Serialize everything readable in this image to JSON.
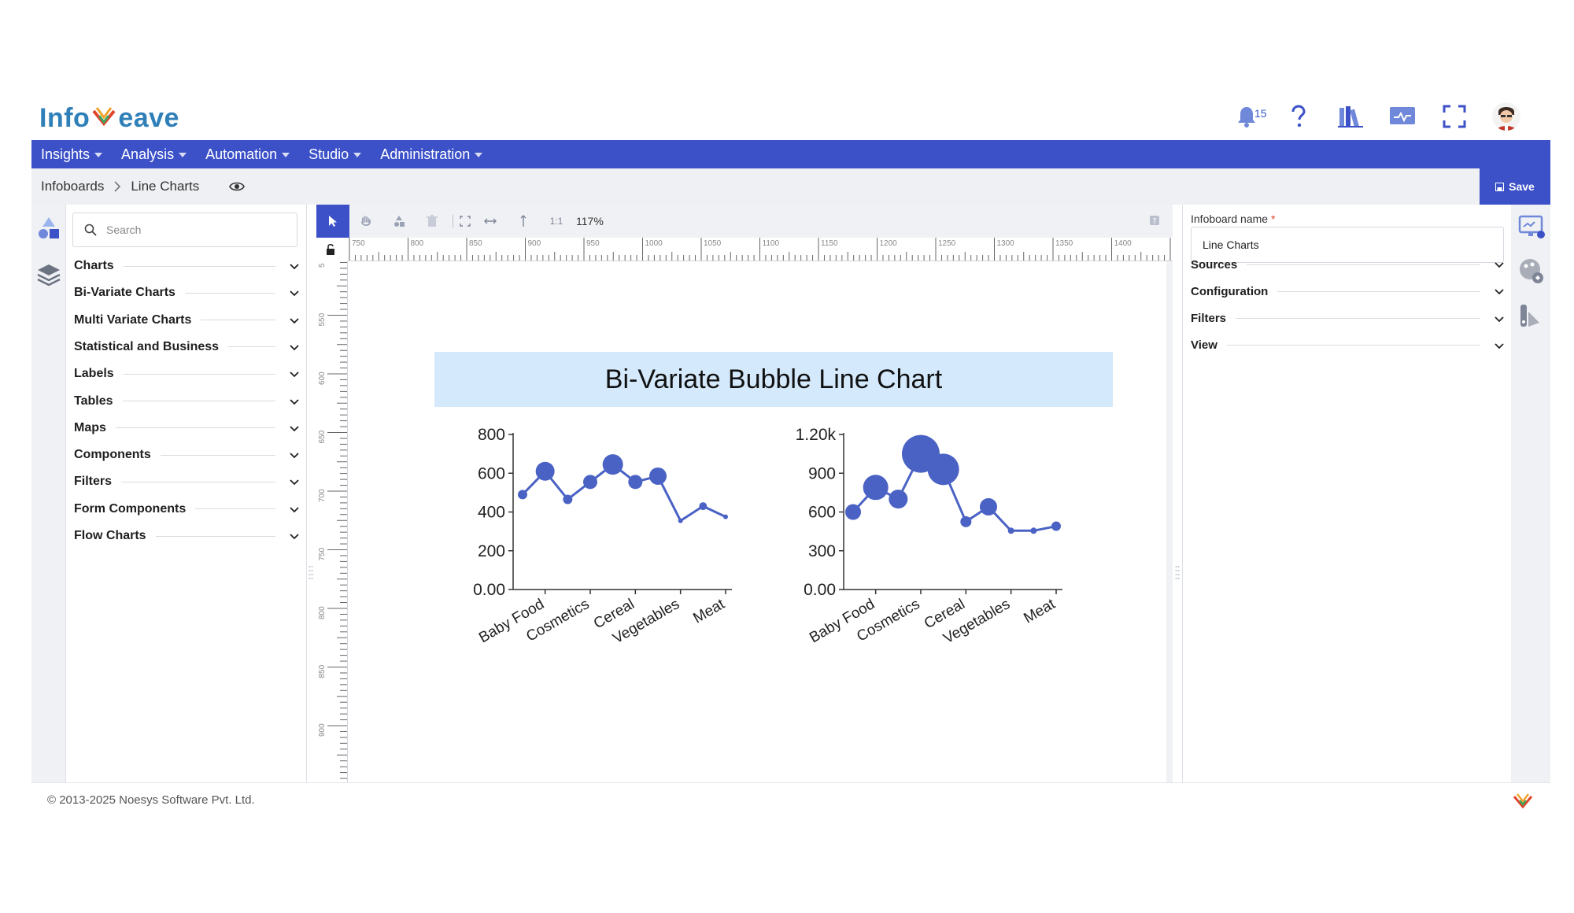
{
  "header": {
    "logo_text_left": "Info",
    "logo_text_right": "eave",
    "notification_count": "15"
  },
  "menu": [
    {
      "label": "Insights"
    },
    {
      "label": "Analysis"
    },
    {
      "label": "Automation"
    },
    {
      "label": "Studio"
    },
    {
      "label": "Administration"
    }
  ],
  "breadcrumb": {
    "root": "Infoboards",
    "current": "Line Charts",
    "save_label": "Save"
  },
  "left_panel": {
    "search_placeholder": "Search",
    "categories": [
      {
        "label": "Charts"
      },
      {
        "label": "Bi-Variate Charts"
      },
      {
        "label": "Multi Variate Charts"
      },
      {
        "label": "Statistical and Business"
      },
      {
        "label": "Labels"
      },
      {
        "label": "Tables"
      },
      {
        "label": "Maps"
      },
      {
        "label": "Components"
      },
      {
        "label": "Filters"
      },
      {
        "label": "Form Components"
      },
      {
        "label": "Flow Charts"
      }
    ]
  },
  "toolbar": {
    "ratio_label": "1:1",
    "zoom": "117%"
  },
  "rulers": {
    "top_ticks": [
      "750",
      "800",
      "850",
      "900",
      "950",
      "1000",
      "1050",
      "1100",
      "1150",
      "1200",
      "1250",
      "1300",
      "1350",
      "1400",
      "14"
    ],
    "left_ticks": [
      "5",
      "550",
      "600",
      "650",
      "700",
      "750",
      "800",
      "850",
      "900"
    ]
  },
  "right_panel": {
    "name_label": "Infoboard name",
    "name_required": "*",
    "name_value": "Line Charts",
    "sections": [
      {
        "label": "Sources"
      },
      {
        "label": "Configuration"
      },
      {
        "label": "Filters"
      },
      {
        "label": "View"
      }
    ]
  },
  "footer": {
    "copyright": "© 2013-2025 Noesys Software Pvt. Ltd."
  },
  "colors": {
    "brand": "#3c51c8",
    "series": "#4a62c4",
    "title_bg": "#d4e9fb"
  },
  "chart_data": [
    {
      "type": "line",
      "title": "Bi-Variate Bubble Line Chart",
      "categories": [
        "Baby Food",
        "",
        "Cosmetics",
        "",
        "Cereal",
        "",
        "Vegetables",
        "",
        "Meat",
        ""
      ],
      "x_tick_labels": [
        "Baby Food",
        "Cosmetics",
        "Cereal",
        "Vegetables",
        "Meat"
      ],
      "y_tick_labels": [
        "800",
        "600",
        "400",
        "200",
        "0.00"
      ],
      "ylim": [
        0,
        800
      ],
      "series": [
        {
          "values": [
            490,
            610,
            465,
            555,
            645,
            555,
            585,
            355,
            430,
            375
          ],
          "bubble_size": [
            6,
            12,
            6,
            9,
            13,
            9,
            11,
            3,
            5,
            3
          ]
        }
      ]
    },
    {
      "type": "line",
      "title": "Bi-Variate Bubble Line Chart",
      "categories": [
        "Baby Food",
        "",
        "Cosmetics",
        "",
        "Cereal",
        "",
        "Vegetables",
        "",
        "Meat",
        ""
      ],
      "x_tick_labels": [
        "Baby Food",
        "Cosmetics",
        "Cereal",
        "Vegetables",
        "Meat"
      ],
      "y_tick_labels": [
        "1.20k",
        "900",
        "600",
        "300",
        "0.00"
      ],
      "ylim": [
        0,
        1200
      ],
      "series": [
        {
          "values": [
            600,
            790,
            700,
            1050,
            930,
            525,
            640,
            455,
            455,
            490
          ],
          "bubble_size": [
            10,
            16,
            12,
            24,
            20,
            7,
            11,
            4,
            4,
            6
          ]
        }
      ]
    }
  ]
}
